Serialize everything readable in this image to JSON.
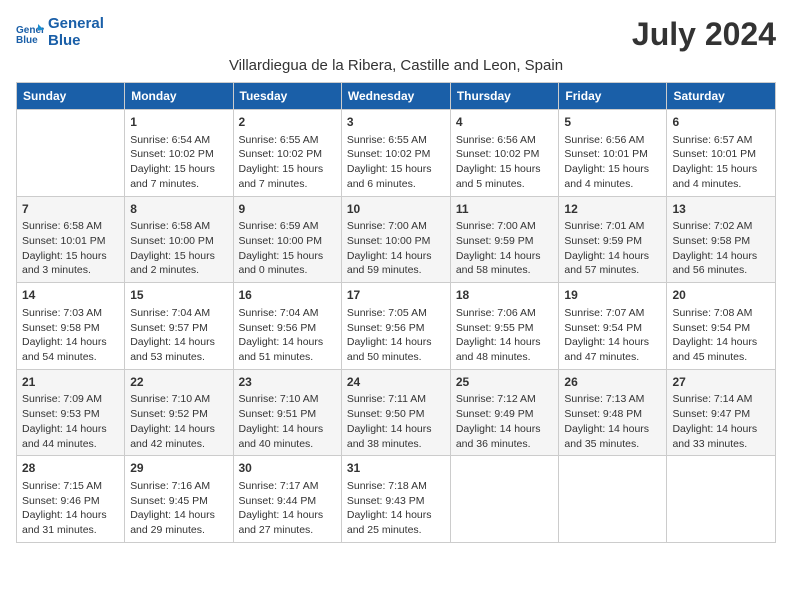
{
  "header": {
    "month_title": "July 2024",
    "location": "Villardiegua de la Ribera, Castille and Leon, Spain",
    "logo_line1": "General",
    "logo_line2": "Blue"
  },
  "columns": [
    "Sunday",
    "Monday",
    "Tuesday",
    "Wednesday",
    "Thursday",
    "Friday",
    "Saturday"
  ],
  "weeks": [
    [
      {
        "day": "",
        "content": ""
      },
      {
        "day": "1",
        "content": "Sunrise: 6:54 AM\nSunset: 10:02 PM\nDaylight: 15 hours\nand 7 minutes."
      },
      {
        "day": "2",
        "content": "Sunrise: 6:55 AM\nSunset: 10:02 PM\nDaylight: 15 hours\nand 7 minutes."
      },
      {
        "day": "3",
        "content": "Sunrise: 6:55 AM\nSunset: 10:02 PM\nDaylight: 15 hours\nand 6 minutes."
      },
      {
        "day": "4",
        "content": "Sunrise: 6:56 AM\nSunset: 10:02 PM\nDaylight: 15 hours\nand 5 minutes."
      },
      {
        "day": "5",
        "content": "Sunrise: 6:56 AM\nSunset: 10:01 PM\nDaylight: 15 hours\nand 4 minutes."
      },
      {
        "day": "6",
        "content": "Sunrise: 6:57 AM\nSunset: 10:01 PM\nDaylight: 15 hours\nand 4 minutes."
      }
    ],
    [
      {
        "day": "7",
        "content": "Sunrise: 6:58 AM\nSunset: 10:01 PM\nDaylight: 15 hours\nand 3 minutes."
      },
      {
        "day": "8",
        "content": "Sunrise: 6:58 AM\nSunset: 10:00 PM\nDaylight: 15 hours\nand 2 minutes."
      },
      {
        "day": "9",
        "content": "Sunrise: 6:59 AM\nSunset: 10:00 PM\nDaylight: 15 hours\nand 0 minutes."
      },
      {
        "day": "10",
        "content": "Sunrise: 7:00 AM\nSunset: 10:00 PM\nDaylight: 14 hours\nand 59 minutes."
      },
      {
        "day": "11",
        "content": "Sunrise: 7:00 AM\nSunset: 9:59 PM\nDaylight: 14 hours\nand 58 minutes."
      },
      {
        "day": "12",
        "content": "Sunrise: 7:01 AM\nSunset: 9:59 PM\nDaylight: 14 hours\nand 57 minutes."
      },
      {
        "day": "13",
        "content": "Sunrise: 7:02 AM\nSunset: 9:58 PM\nDaylight: 14 hours\nand 56 minutes."
      }
    ],
    [
      {
        "day": "14",
        "content": "Sunrise: 7:03 AM\nSunset: 9:58 PM\nDaylight: 14 hours\nand 54 minutes."
      },
      {
        "day": "15",
        "content": "Sunrise: 7:04 AM\nSunset: 9:57 PM\nDaylight: 14 hours\nand 53 minutes."
      },
      {
        "day": "16",
        "content": "Sunrise: 7:04 AM\nSunset: 9:56 PM\nDaylight: 14 hours\nand 51 minutes."
      },
      {
        "day": "17",
        "content": "Sunrise: 7:05 AM\nSunset: 9:56 PM\nDaylight: 14 hours\nand 50 minutes."
      },
      {
        "day": "18",
        "content": "Sunrise: 7:06 AM\nSunset: 9:55 PM\nDaylight: 14 hours\nand 48 minutes."
      },
      {
        "day": "19",
        "content": "Sunrise: 7:07 AM\nSunset: 9:54 PM\nDaylight: 14 hours\nand 47 minutes."
      },
      {
        "day": "20",
        "content": "Sunrise: 7:08 AM\nSunset: 9:54 PM\nDaylight: 14 hours\nand 45 minutes."
      }
    ],
    [
      {
        "day": "21",
        "content": "Sunrise: 7:09 AM\nSunset: 9:53 PM\nDaylight: 14 hours\nand 44 minutes."
      },
      {
        "day": "22",
        "content": "Sunrise: 7:10 AM\nSunset: 9:52 PM\nDaylight: 14 hours\nand 42 minutes."
      },
      {
        "day": "23",
        "content": "Sunrise: 7:10 AM\nSunset: 9:51 PM\nDaylight: 14 hours\nand 40 minutes."
      },
      {
        "day": "24",
        "content": "Sunrise: 7:11 AM\nSunset: 9:50 PM\nDaylight: 14 hours\nand 38 minutes."
      },
      {
        "day": "25",
        "content": "Sunrise: 7:12 AM\nSunset: 9:49 PM\nDaylight: 14 hours\nand 36 minutes."
      },
      {
        "day": "26",
        "content": "Sunrise: 7:13 AM\nSunset: 9:48 PM\nDaylight: 14 hours\nand 35 minutes."
      },
      {
        "day": "27",
        "content": "Sunrise: 7:14 AM\nSunset: 9:47 PM\nDaylight: 14 hours\nand 33 minutes."
      }
    ],
    [
      {
        "day": "28",
        "content": "Sunrise: 7:15 AM\nSunset: 9:46 PM\nDaylight: 14 hours\nand 31 minutes."
      },
      {
        "day": "29",
        "content": "Sunrise: 7:16 AM\nSunset: 9:45 PM\nDaylight: 14 hours\nand 29 minutes."
      },
      {
        "day": "30",
        "content": "Sunrise: 7:17 AM\nSunset: 9:44 PM\nDaylight: 14 hours\nand 27 minutes."
      },
      {
        "day": "31",
        "content": "Sunrise: 7:18 AM\nSunset: 9:43 PM\nDaylight: 14 hours\nand 25 minutes."
      },
      {
        "day": "",
        "content": ""
      },
      {
        "day": "",
        "content": ""
      },
      {
        "day": "",
        "content": ""
      }
    ]
  ]
}
